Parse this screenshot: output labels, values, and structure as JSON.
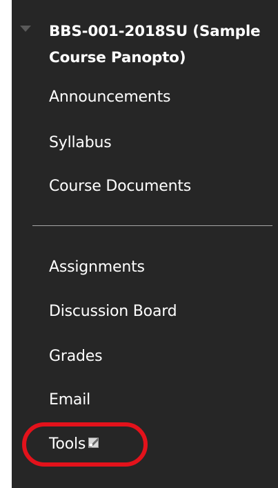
{
  "course": {
    "title": "BBS-001-2018SU (Sample Course Panopto)",
    "collapse_icon": "triangle-down-icon"
  },
  "menu": {
    "group1": [
      {
        "label": "Announcements"
      },
      {
        "label": "Syllabus"
      },
      {
        "label": "Course Documents"
      }
    ],
    "group2": [
      {
        "label": "Assignments"
      },
      {
        "label": "Discussion Board"
      },
      {
        "label": "Grades"
      },
      {
        "label": "Email"
      },
      {
        "label": "Tools",
        "icon": "edit-icon"
      }
    ]
  },
  "colors": {
    "panel_bg": "#262626",
    "text": "#ffffff",
    "divider": "#a8a8a8",
    "highlight": "#e3121b"
  }
}
